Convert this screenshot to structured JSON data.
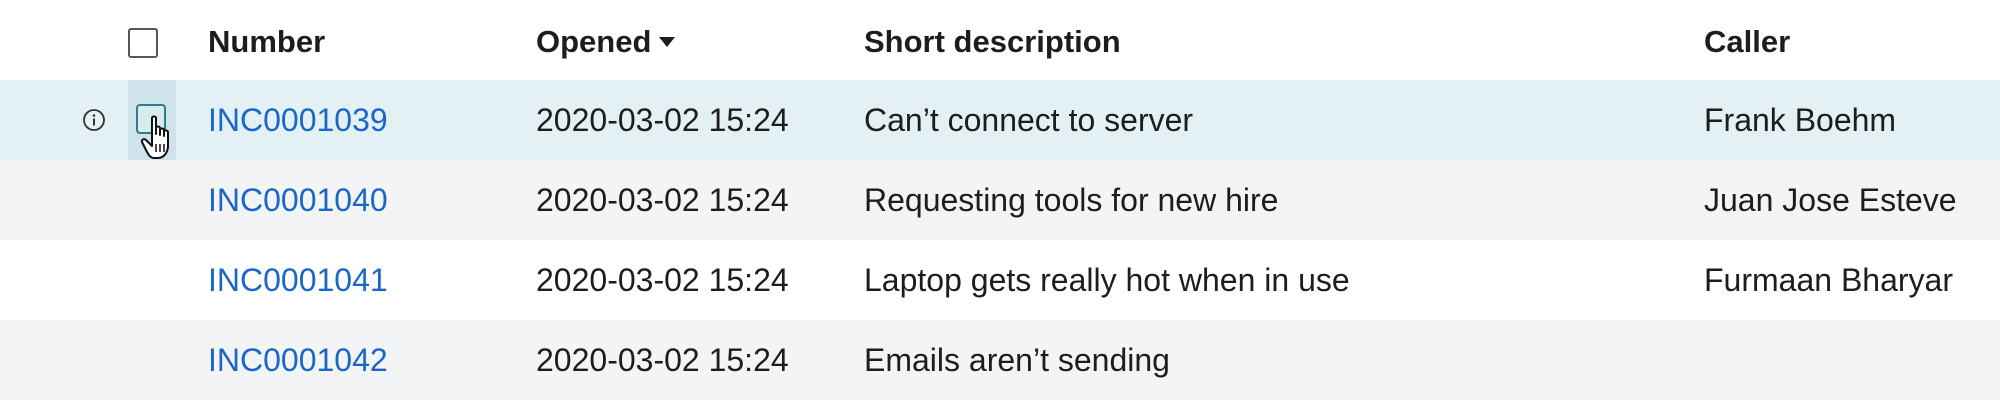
{
  "header": {
    "number": "Number",
    "opened": "Opened",
    "short_description": "Short description",
    "caller": "Caller"
  },
  "rows": [
    {
      "number": "INC0001039",
      "opened": "2020-03-02 15:24",
      "short_description": "Can’t connect to server",
      "caller": "Frank Boehm"
    },
    {
      "number": "INC0001040",
      "opened": "2020-03-02 15:24",
      "short_description": "Requesting tools for new hire",
      "caller": "Juan Jose Esteve"
    },
    {
      "number": "INC0001041",
      "opened": "2020-03-02 15:24",
      "short_description": "Laptop gets really hot when in use",
      "caller": "Furmaan Bharyar"
    },
    {
      "number": "INC0001042",
      "opened": "2020-03-02 15:24",
      "short_description": "Emails aren’t sending",
      "caller": ""
    }
  ],
  "colors": {
    "link": "#1b67c9",
    "hover_row": "#e3f0f4",
    "alt_row": "#f3f4f5"
  },
  "icons": {
    "sort": "caret-down-icon",
    "info": "info-circle-icon",
    "cursor": "hand-pointer-icon"
  }
}
